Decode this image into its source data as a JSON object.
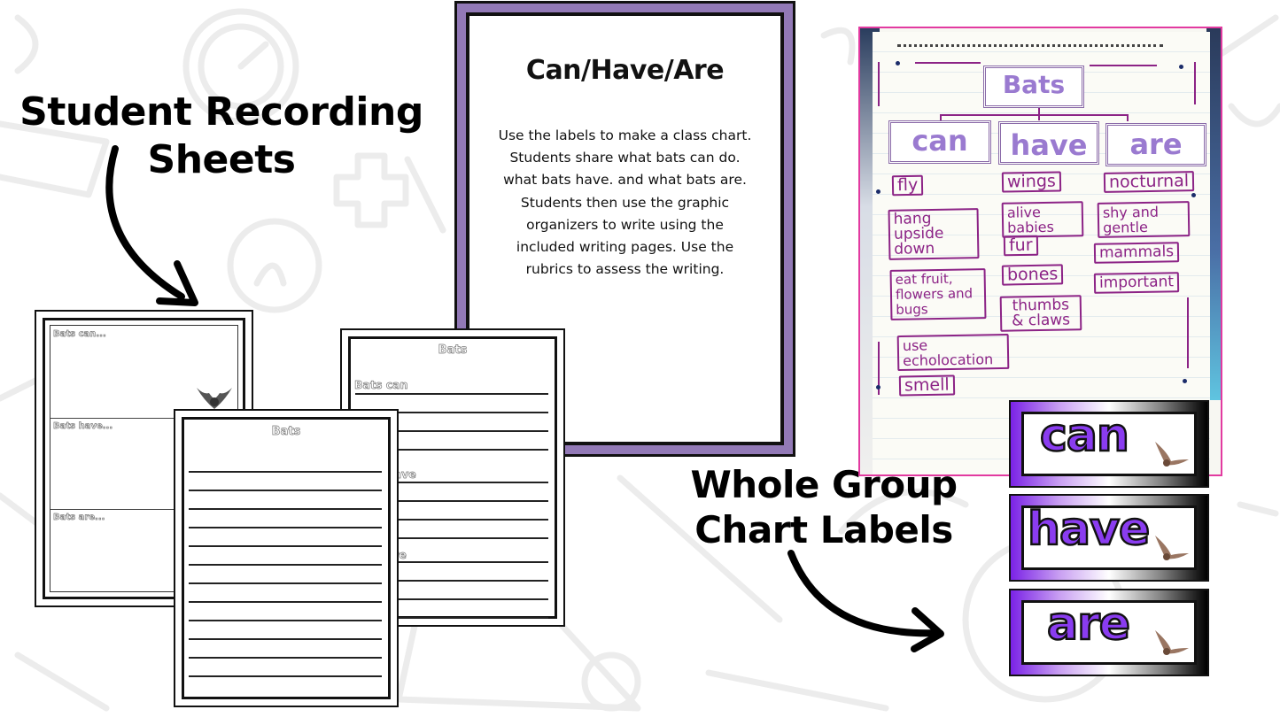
{
  "captions": {
    "left_line1": "Student Recording",
    "left_line2": "Sheets",
    "right_line1": "Whole Group",
    "right_line2": "Chart Labels"
  },
  "instruction_card": {
    "title": "Can/Have/Are",
    "body_lines": [
      "Use the labels to make a class chart.",
      "Students share what bats can do.",
      "what bats have. and what bats are.",
      "Students then use the graphic",
      "organizers to write using the",
      "included writing pages. Use the",
      "rubrics to assess the writing."
    ]
  },
  "sheets": {
    "organizer": {
      "sections": [
        "Bats can...",
        "Bats have...",
        "Bats are..."
      ]
    },
    "lined_prompts": {
      "title": "Bats",
      "prompts": [
        "Bats can",
        "Bats have",
        "Bats are"
      ]
    },
    "lined_blank": {
      "title": "Bats"
    }
  },
  "chart_photo": {
    "title": "Bats",
    "headers": [
      "can",
      "have",
      "are"
    ],
    "columns": {
      "can": [
        "fly",
        "hang upside down",
        "eat fruit, flowers and bugs",
        "use echolocation",
        "smell"
      ],
      "have": [
        "wings",
        "alive babies",
        "fur",
        "bones",
        "thumbs & claws"
      ],
      "are": [
        "nocturnal",
        "shy and gentle",
        "mammals",
        "important"
      ]
    }
  },
  "chart_labels": [
    "can",
    "have",
    "are"
  ],
  "colors": {
    "card_purple": "#9279b6",
    "marker_purple": "#8c2386",
    "label_purple": "#8a3cf0",
    "photo_border": "#e23aa0"
  }
}
